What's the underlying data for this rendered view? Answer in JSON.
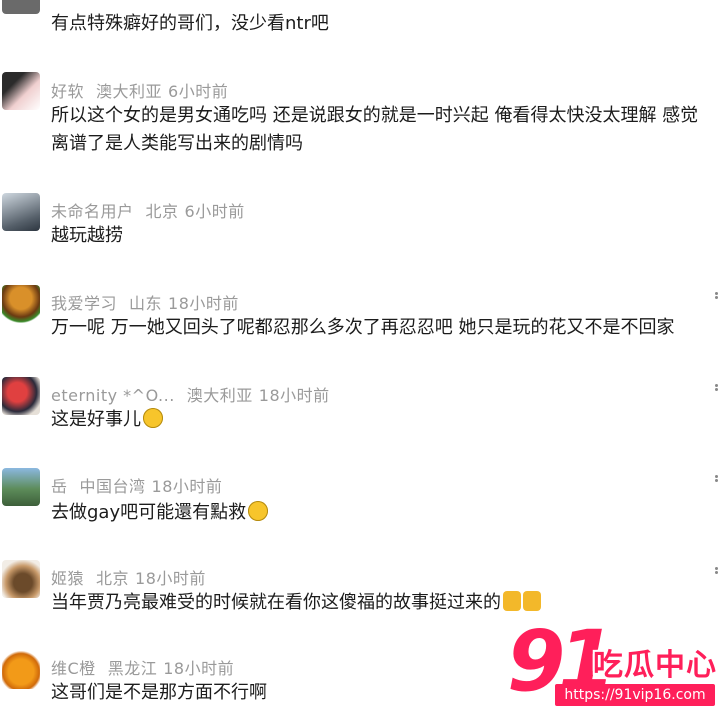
{
  "comments": [
    {
      "user": "",
      "location": "",
      "time": "",
      "text": "有点特殊癖好的哥们，没少看ntr吧"
    },
    {
      "user": "好软",
      "location": "澳大利亚",
      "time": "6小时前",
      "text": "所以这个女的是男女通吃吗 还是说跟女的就是一时兴起 俺看得太快没太理解 感觉",
      "text2": "离谱了是人类能写出来的剧情吗"
    },
    {
      "user": "未命名用户",
      "location": "北京",
      "time": "6小时前",
      "text": "越玩越捞"
    },
    {
      "user": "我爱学习",
      "location": "山东",
      "time": "18小时前",
      "text": "万一呢 万一她又回头了呢都忍那么多次了再忍忍吧  她只是玩的花又不是不回家"
    },
    {
      "user": "eternity *^O...",
      "location": "澳大利亚",
      "time": "18小时前",
      "text": "这是好事儿"
    },
    {
      "user": "岳",
      "location": "中国台湾",
      "time": "18小时前",
      "text": "去做gay吧可能還有點救"
    },
    {
      "user": "姬猿",
      "location": "北京",
      "time": "18小时前",
      "text": "当年贾乃亮最难受的时候就在看你这傻福的故事挺过来的"
    },
    {
      "user": "维C橙",
      "location": "黑龙江",
      "time": "18小时前",
      "text": "这哥们是不是那方面不行啊"
    }
  ],
  "watermark": {
    "number": "91",
    "title": "吃瓜中心",
    "url": "https://91vip16.com"
  },
  "colors": {
    "meta": "#9a9a9a",
    "text": "#1c1c1c",
    "brand": "#ff1f5a"
  }
}
